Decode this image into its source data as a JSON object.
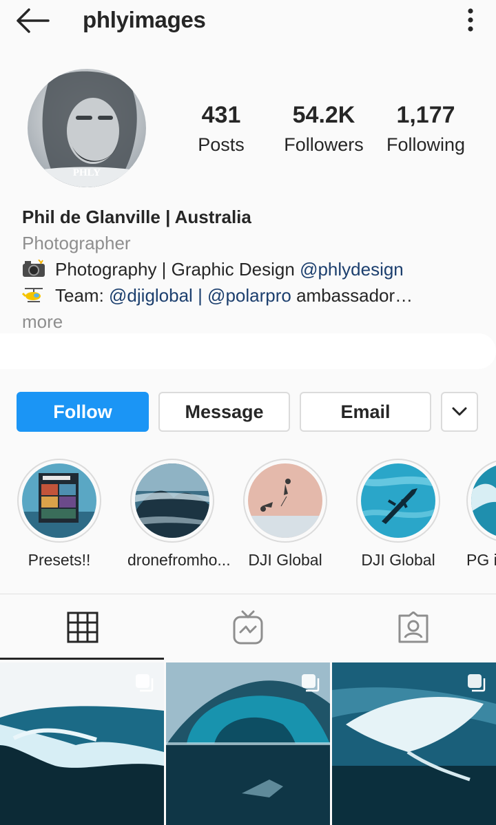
{
  "header": {
    "username": "phlyimages",
    "back_icon": "arrow-left-icon",
    "menu_icon": "more-vertical-icon"
  },
  "profile": {
    "avatar_watermark": "PHLY",
    "stats": [
      {
        "value": "431",
        "label": "Posts"
      },
      {
        "value": "54.2K",
        "label": "Followers"
      },
      {
        "value": "1,177",
        "label": "Following"
      }
    ]
  },
  "bio": {
    "name": "Phil de Glanville | Australia",
    "category": "Photographer",
    "line1_text": "Photography | Graphic Design ",
    "line1_link": "@phlydesign",
    "line2_text": "Team: ",
    "line2_link1": "@djiglobal",
    "line2_sep": " | ",
    "line2_link2": "@polarpro",
    "line2_tail": " ambassador…",
    "more": "more"
  },
  "actions": {
    "follow": "Follow",
    "message": "Message",
    "email": "Email",
    "dropdown_icon": "chevron-down-icon"
  },
  "highlights": [
    {
      "label": "Presets!!"
    },
    {
      "label": "dronefromho..."
    },
    {
      "label": "DJI Global"
    },
    {
      "label": "DJI Global"
    },
    {
      "label": "PG i"
    }
  ],
  "tabs": [
    {
      "icon": "grid-icon"
    },
    {
      "icon": "igtv-icon"
    },
    {
      "icon": "tagged-icon"
    }
  ],
  "colors": {
    "accent": "#1b95f5",
    "link": "#1c3f6e",
    "muted": "#8e8e8e"
  }
}
